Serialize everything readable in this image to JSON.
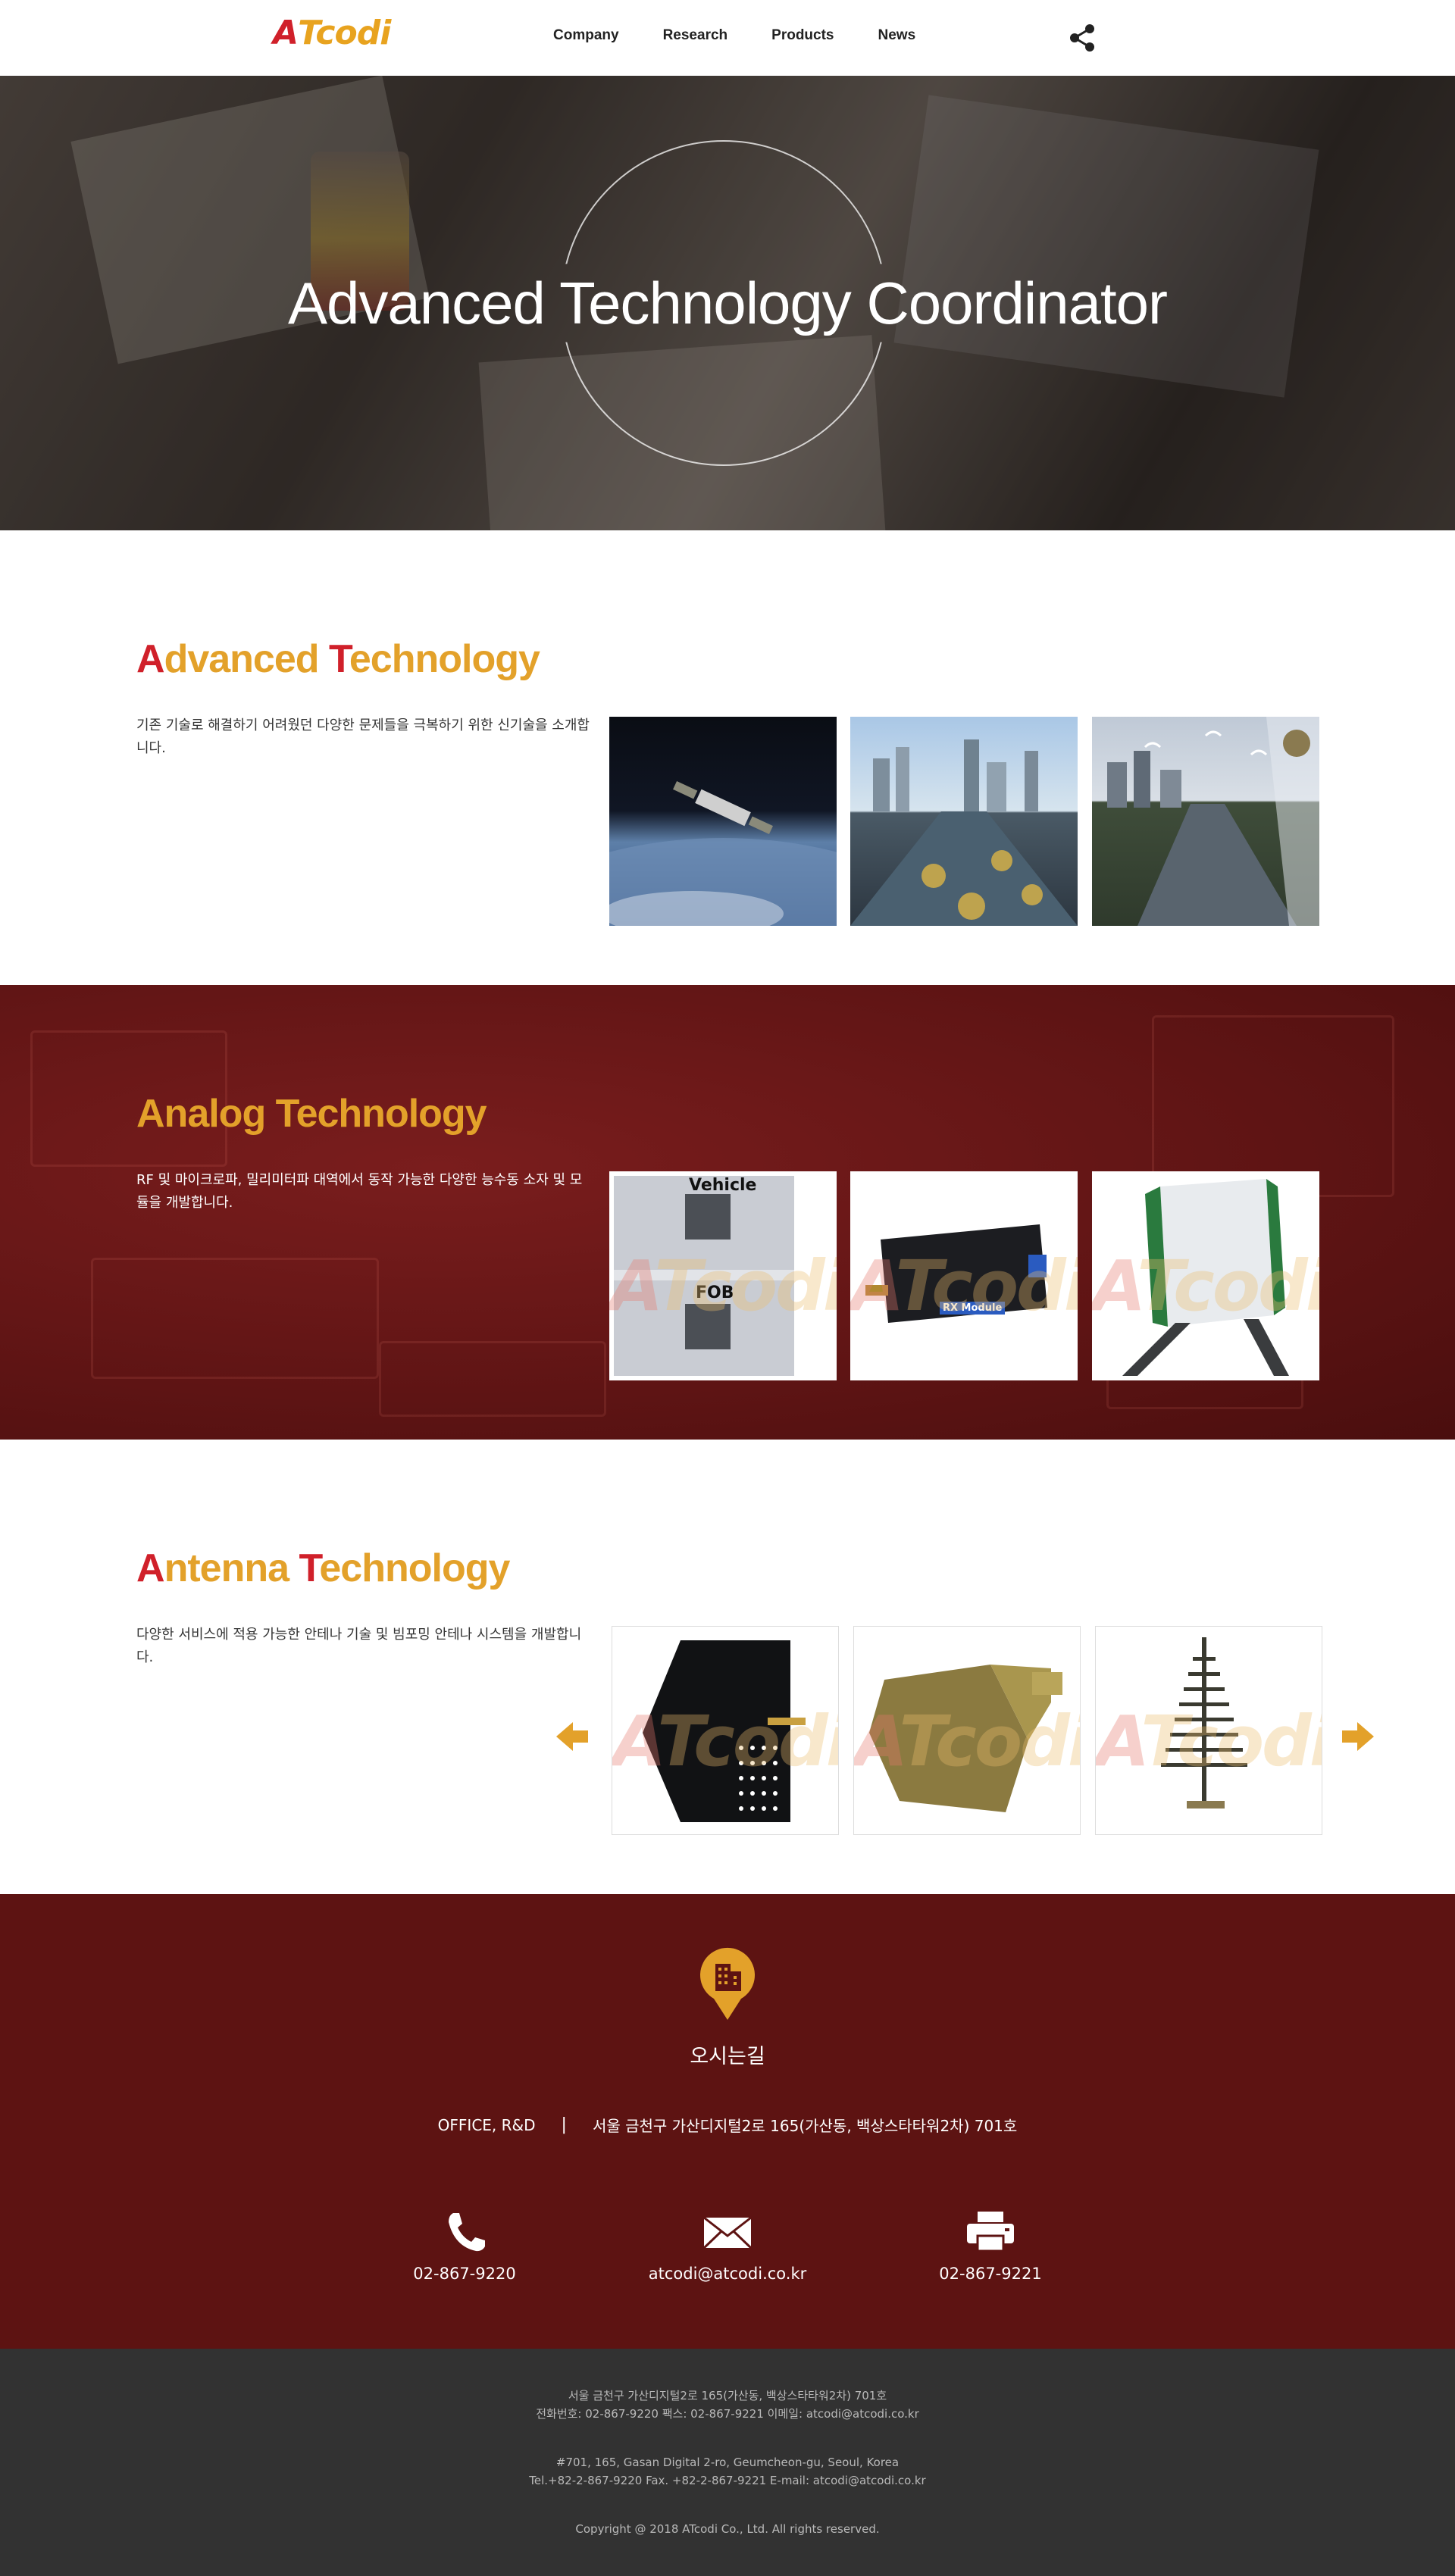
{
  "header": {
    "logo_first": "A",
    "logo_rest": "Tcodi",
    "nav": [
      "Company",
      "Research",
      "Products",
      "News"
    ],
    "share_icon": "share-icon"
  },
  "hero": {
    "title": "Advanced Technology Coordinator"
  },
  "sections": [
    {
      "title_parts": [
        "A",
        "dvanced ",
        "T",
        "echnology"
      ],
      "description": "기존 기술로 해결하기 어려웠던 다양한 문제들을 극복하기 위한 신기술을 소개합니다."
    },
    {
      "title_parts": [
        "",
        "Analog ",
        "",
        "Technology"
      ],
      "description": "RF 및 마이크로파, 밀리미터파 대역에서 동작 가능한 다양한 능수동 소자 및 모듈을 개발합니다.",
      "thumb_labels": [
        "Vehicle",
        "FOB",
        "RX Module"
      ]
    },
    {
      "title_parts": [
        "A",
        "ntenna ",
        "T",
        "echnology"
      ],
      "description": "다양한 서비스에 적용 가능한 안테나 기술 및 빔포밍 안테나 시스템을 개발합니다."
    }
  ],
  "watermark": {
    "first": "A",
    "rest": "Tcodi"
  },
  "contact": {
    "title": "오시는길",
    "office_label": "OFFICE, R&D",
    "office_separator": "|",
    "office_address": "서울 금천구 가산디지털2로 165(가산동, 백상스타타워2차) 701호",
    "phone": "02-867-9220",
    "email": "atcodi@atcodi.co.kr",
    "fax": "02-867-9221"
  },
  "footer": {
    "kr_line1": "서울 금천구 가산디지털2로 165(가산동, 백상스타타워2차) 701호",
    "kr_line2": "전화번호: 02-867-9220 팩스: 02-867-9221 이메일: atcodi@atcodi.co.kr",
    "en_line1": "#701, 165, Gasan Digital 2-ro, Geumcheon-gu, Seoul, Korea",
    "en_line2": "Tel.+82-2-867-9220 Fax. +82-2-867-9221 E-mail: atcodi@atcodi.co.kr",
    "copyright": "Copyright @ 2018 ATcodi Co., Ltd. All rights reserved."
  },
  "colors": {
    "brand_red": "#d0202a",
    "brand_yellow": "#e3a12a",
    "maroon": "#5d1312",
    "footer_bg": "#323232"
  }
}
